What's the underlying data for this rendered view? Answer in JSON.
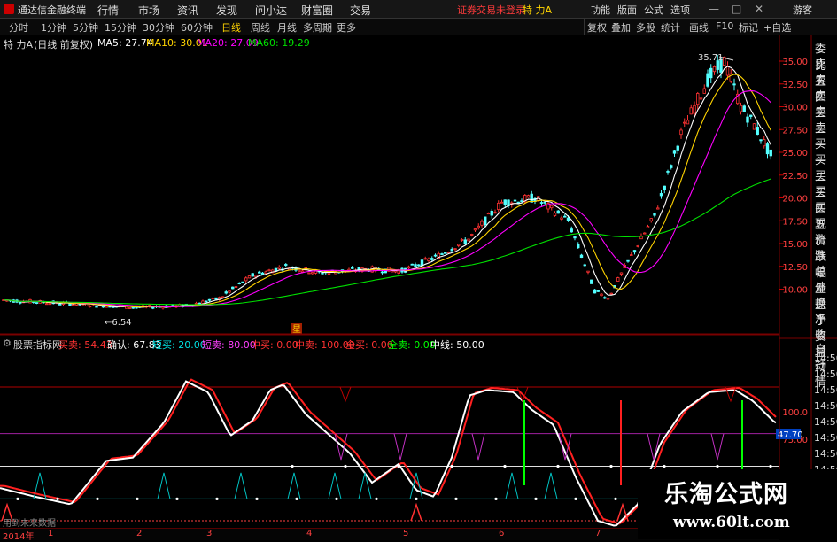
{
  "menubar": {
    "app_title": "通达信金融终端",
    "menus": [
      "行情",
      "市场",
      "资讯",
      "发现",
      "问小达",
      "财富圈",
      "交易"
    ],
    "login_status": "证券交易未登录",
    "stock_name": "特 力A",
    "right_menus": [
      "功能",
      "版面",
      "公式",
      "选项"
    ],
    "window_buttons": [
      "—",
      "□",
      "✕"
    ],
    "guest": "游客"
  },
  "tabs": {
    "items": [
      "分时",
      "1分钟",
      "5分钟",
      "15分钟",
      "30分钟",
      "60分钟",
      "日线",
      "周线",
      "月线",
      "多周期",
      "更多"
    ],
    "active": "日线",
    "tools": [
      "复权",
      "叠加",
      "多股",
      "统计",
      "画线",
      "F10",
      "标记",
      "+自选"
    ]
  },
  "price_panel": {
    "title": "特 力A",
    "subtitle": "(日线 前复权)",
    "ma5_label": "MA5: 27.74",
    "ma10_label": "MA10: 30.01",
    "ma20_label": "MA20: 27.09",
    "ma60_label": "MA60: 19.29",
    "high_marker": "35.71",
    "low_marker": "6.54",
    "event_marker": "星",
    "axis_ticks": [
      "35.00",
      "32.50",
      "30.00",
      "27.50",
      "25.00",
      "22.50",
      "20.00",
      "17.50",
      "15.00",
      "12.50",
      "10.00"
    ],
    "colors": {
      "up": "#ff3232",
      "down": "#54ffff",
      "ma5": "#ffffff",
      "ma10": "#ffd400",
      "ma20": "#ff00ff",
      "ma60": "#00e000"
    }
  },
  "side_panel": {
    "items": [
      "委比",
      "卖五",
      "卖四",
      "卖三",
      "卖二",
      "卖一",
      "买一",
      "买二",
      "买三",
      "买四",
      "买五",
      "现价",
      "涨跌",
      "涨幅",
      "总量",
      "外盘",
      "换手",
      "净资",
      "收益"
    ],
    "items2": [
      "自动",
      "行情"
    ]
  },
  "indicator_panel": {
    "title": "股票指标网",
    "params": [
      {
        "label": "买卖: 54.43",
        "color": "#ff3232"
      },
      {
        "label": "确认: 67.83",
        "color": "#ffffff"
      },
      {
        "label": "短买: 20.00",
        "color": "#00e0e0"
      },
      {
        "label": "短卖: 80.00",
        "color": "#ff40ff"
      },
      {
        "label": "中买: 0.00",
        "color": "#ff3232"
      },
      {
        "label": "中卖: 100.00",
        "color": "#ff3232"
      },
      {
        "label": "全买: 0.00",
        "color": "#ff3232"
      },
      {
        "label": "全卖: 0.00",
        "color": "#00ff00"
      },
      {
        "label": "中线: 50.00",
        "color": "#ffffff"
      }
    ],
    "axis_ticks": [
      "100.0",
      "75.00"
    ],
    "current_value": "47.70",
    "right_times": [
      "14:50",
      "14:50",
      "14:50",
      "14:50",
      "14:50",
      "14:50",
      "14:50",
      "14:50",
      "14:50",
      "14:50"
    ],
    "note": "用到未来数据"
  },
  "date_axis": {
    "labels": [
      "2014年",
      "1",
      "2",
      "3",
      "4",
      "5",
      "6",
      "7"
    ]
  },
  "watermark": {
    "title": "乐淘公式网",
    "url": "www.60lt.com"
  }
}
